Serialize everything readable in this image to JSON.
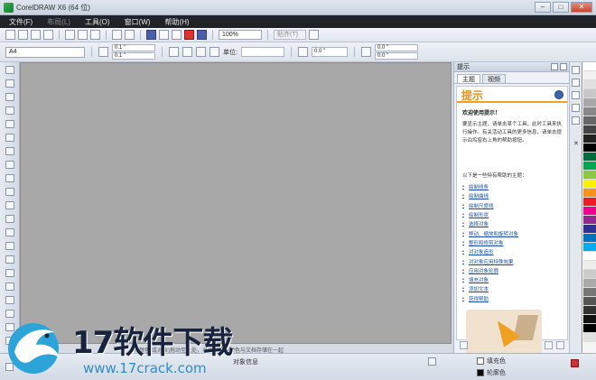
{
  "window": {
    "title": "CorelDRAW X6 (64 位)",
    "controls": [
      "–",
      "□",
      "✕"
    ]
  },
  "menu": {
    "items": [
      {
        "label": "文件(F)",
        "enabled": true
      },
      {
        "label": "布局(L)",
        "enabled": false
      },
      {
        "label": "工具(O)",
        "enabled": true
      },
      {
        "label": "窗口(W)",
        "enabled": true
      },
      {
        "label": "帮助(H)",
        "enabled": true
      }
    ]
  },
  "toolbar": {
    "zoom": "100%",
    "snap_label": "贴齐(T)"
  },
  "property_bar": {
    "page_size": "A4",
    "width": "0.1 \"",
    "height": "0.1 \"",
    "units_label": "单位:",
    "nudge": "0.0 \"",
    "dup_x": "0.0 \"",
    "dup_y": "0.0 \""
  },
  "canvas": {
    "hint_text": "将颜色(或对象)拖动至此处，以便将这些颜色与文档存储在一起"
  },
  "docker": {
    "header": "提示",
    "tabs": [
      "主题",
      "视频"
    ],
    "title": "提示",
    "welcome": "欢迎使用提示！",
    "intro": "要显示主题，请单击某个工具，此时工具来执行操作。有关活动工具的更多信息，请单击提示泊坞窗右上角的帮助按钮。",
    "topics_head": "以下是一些特有帮助的主题：",
    "topics": [
      "绘制线条",
      "绘制曲线",
      "绘制尺度线",
      "绘制形状",
      "选择对象",
      "移动、缩放和旋转对象",
      "整形和修剪对象",
      "对对象造形",
      "对对象应用特殊效果",
      "应用对象轮廓",
      "填充对象",
      "添加文本",
      "获得帮助"
    ]
  },
  "status": {
    "object_info": "对象信息",
    "fill_label": "填充色",
    "outline_label": "轮廓色"
  },
  "watermark": {
    "brand": "17软件下载",
    "url": "www.17crack.com"
  },
  "palette": {
    "colors": [
      "#ffffff",
      "#f2f2f2",
      "#e0e0e0",
      "#c8c8c8",
      "#a8a8a8",
      "#888888",
      "#666666",
      "#444444",
      "#222222",
      "#000000",
      "#006b3c",
      "#00a651",
      "#8dc63f",
      "#fff200",
      "#f7941d",
      "#ed1c24",
      "#ec008c",
      "#92278f",
      "#2e3192",
      "#0072bc",
      "#00aeef",
      "#ffffff",
      "#eeeeee",
      "#cccccc",
      "#aaaaaa",
      "#777777",
      "#555555",
      "#333333",
      "#111111",
      "#000000",
      "#e0e0e0"
    ]
  }
}
